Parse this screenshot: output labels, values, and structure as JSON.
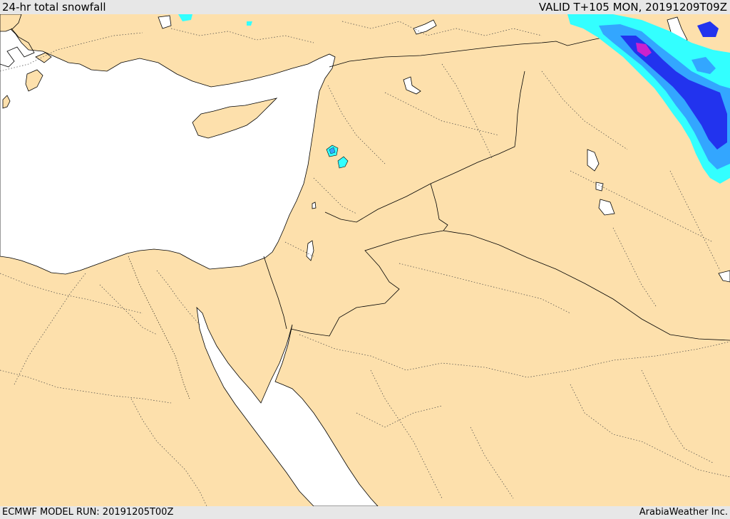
{
  "header": {
    "title": "24-hr total snowfall",
    "valid": "VALID T+105 MON, 20191209T09Z"
  },
  "footer": {
    "model_run": "ECMWF MODEL RUN: 20191205T00Z",
    "credit": "ArabiaWeather Inc."
  },
  "colors": {
    "land": "#fde0ac",
    "water": "#ffffff",
    "snow_light": "#33ffff",
    "snow_medium": "#33a6ff",
    "snow_heavy": "#2233ee",
    "snow_extreme": "#cc22cc",
    "border": "#000000"
  }
}
